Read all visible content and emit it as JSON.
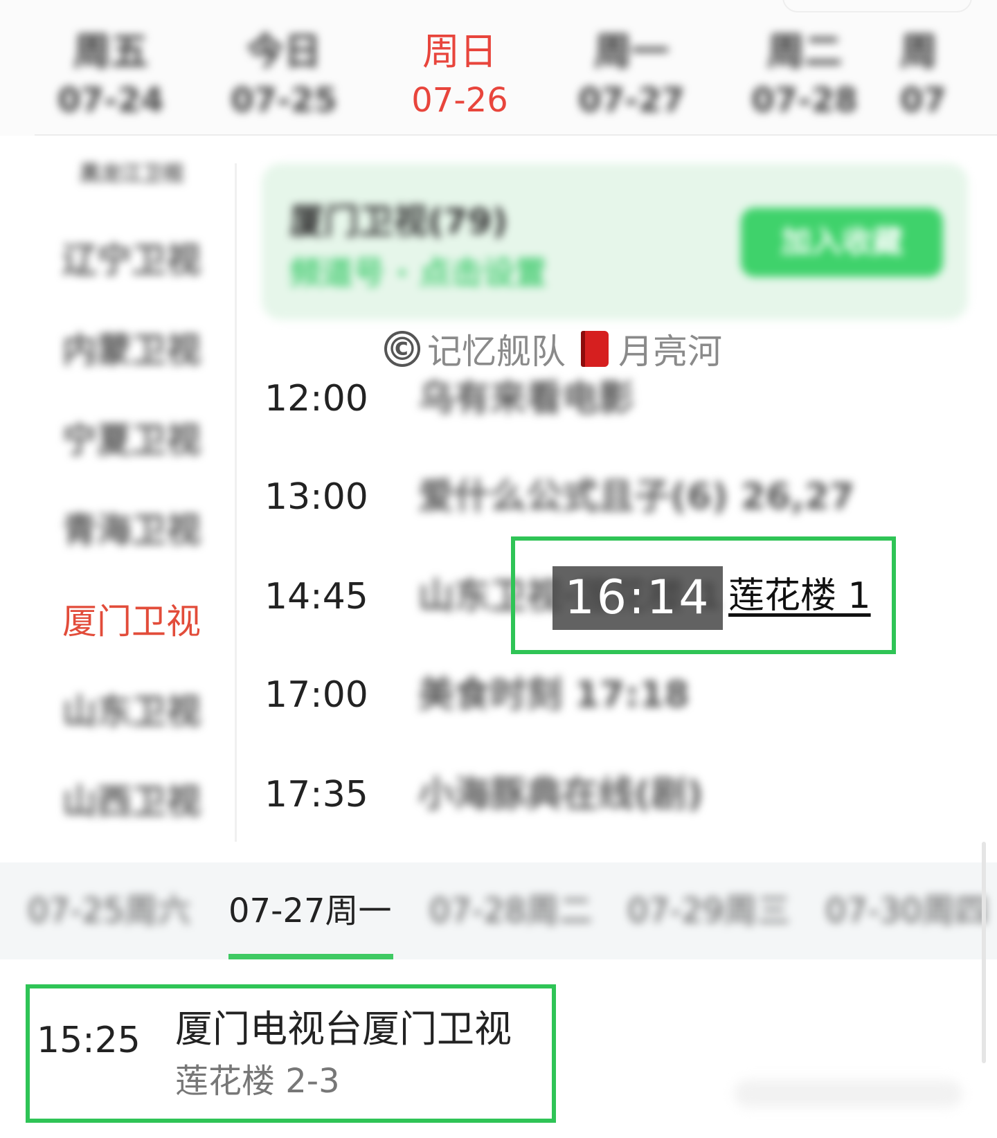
{
  "day_tabs": [
    {
      "name": "周五",
      "date": "07-24"
    },
    {
      "name": "今日",
      "date": "07-25"
    },
    {
      "name": "周日",
      "date": "07-26",
      "active": true
    },
    {
      "name": "周一",
      "date": "07-27"
    },
    {
      "name": "周二",
      "date": "07-28"
    },
    {
      "name": "周",
      "date": "07"
    }
  ],
  "channels": [
    {
      "label": "黑龙江卫视"
    },
    {
      "label": "辽宁卫视"
    },
    {
      "label": "内蒙卫视"
    },
    {
      "label": "宁夏卫视"
    },
    {
      "label": "青海卫视"
    },
    {
      "label": "厦门卫视",
      "active": true
    },
    {
      "label": "山东卫视"
    },
    {
      "label": "山西卫视"
    }
  ],
  "promo": {
    "title": "厦门卫视(79)",
    "subtitle": "频道号 · 点击设置",
    "button": "加入收藏"
  },
  "watermark": {
    "copyright": "©",
    "text1": "记忆舰队",
    "text2": "月亮河"
  },
  "schedule": [
    {
      "time": "12:00",
      "program": "乌有来看电影"
    },
    {
      "time": "13:00",
      "program": "爱什么公式且子(6) 26,27"
    },
    {
      "time": "14:45",
      "program": "山东卫视·莲花楼 1"
    },
    {
      "time": "17:00",
      "program": "美食时刻 17:18"
    },
    {
      "time": "17:35",
      "program": "小海豚典在线(剧)"
    }
  ],
  "highlight": {
    "timestamp": "16:14",
    "title": "莲花楼 1"
  },
  "date_tabs": [
    {
      "label": "07-25周六"
    },
    {
      "label": "07-27周一",
      "active": true
    },
    {
      "label": "07-28周二"
    },
    {
      "label": "07-29周三"
    },
    {
      "label": "07-30周四"
    }
  ],
  "bottom_program": {
    "time": "15:25",
    "channel": "厦门电视台厦门卫视",
    "episode": "莲花楼 2-3"
  },
  "colors": {
    "accent_red": "#e8453c",
    "accent_green": "#3fd26b"
  }
}
